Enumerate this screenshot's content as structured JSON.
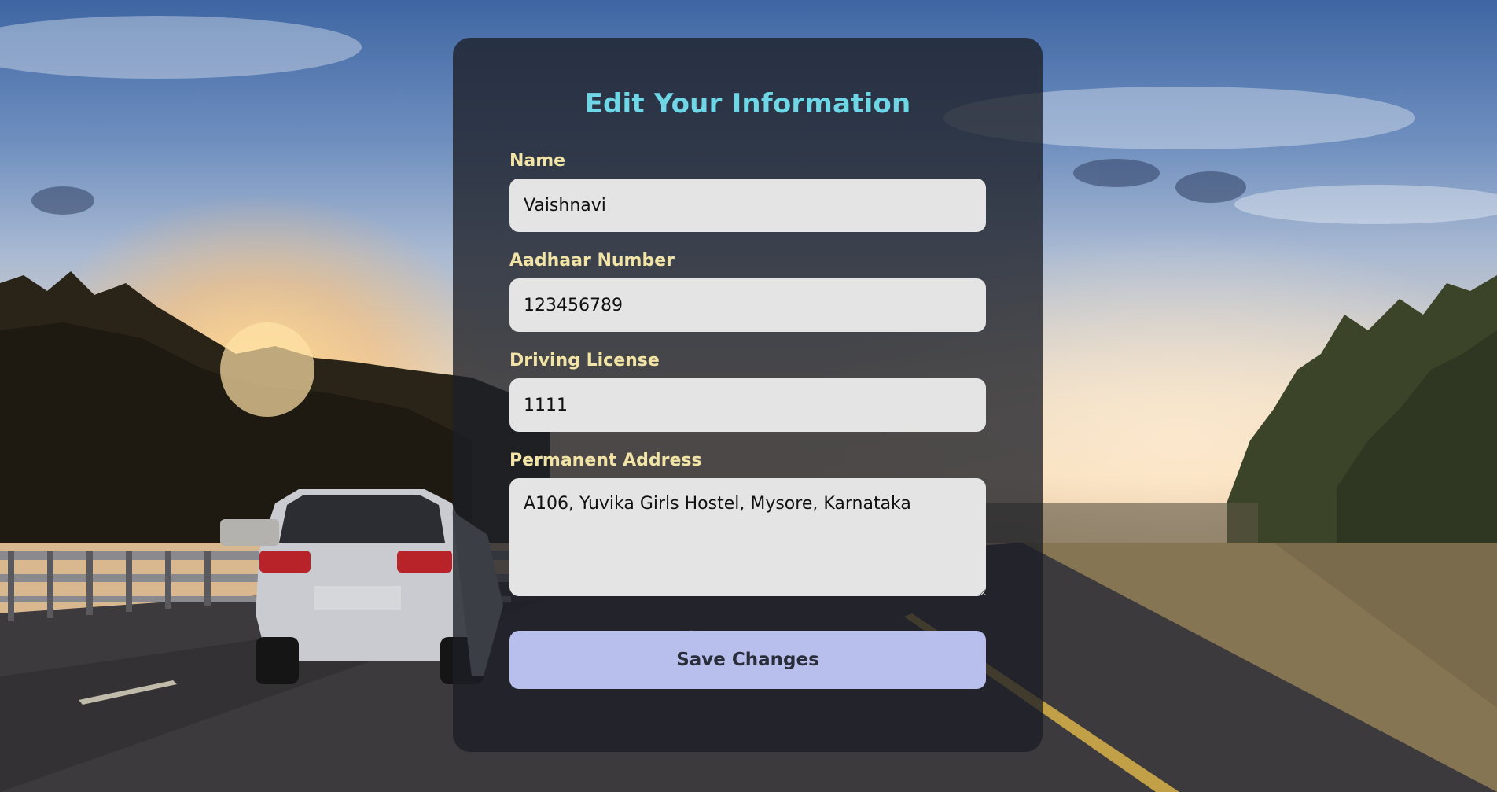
{
  "form": {
    "title": "Edit Your Information",
    "fields": [
      {
        "label": "Name",
        "value": "Vaishnavi"
      },
      {
        "label": "Aadhaar Number",
        "value": "123456789"
      },
      {
        "label": "Driving License",
        "value": "1111"
      },
      {
        "label": "Permanent Address",
        "value": "A106, Yuvika Girls Hostel, Mysore, Karnataka"
      }
    ],
    "submit_label": "Save Changes"
  },
  "colors": {
    "title": "#6fd6e6",
    "label": "#f1e4a6",
    "input_bg": "#e4e4e4",
    "button_bg": "#b8bfed",
    "card_bg": "rgba(28,31,38,0.78)"
  },
  "background": {
    "icon": "highway-sunset-photo"
  }
}
